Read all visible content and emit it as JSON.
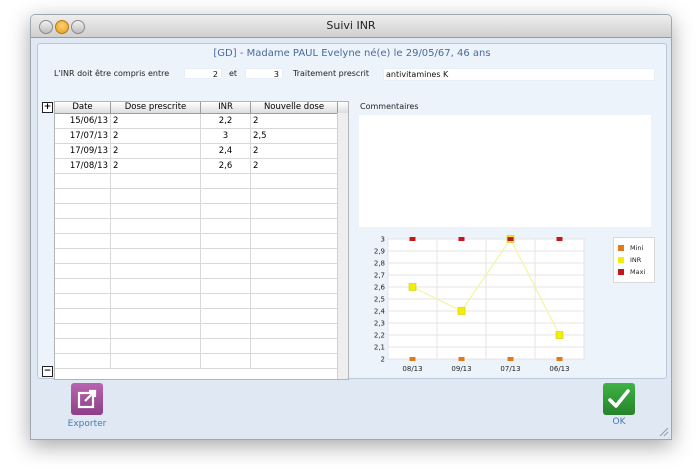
{
  "window": {
    "title": "Suivi INR"
  },
  "patient": {
    "header": "[GD] - Madame PAUL Evelyne   né(e) le 29/05/67, 46 ans"
  },
  "range": {
    "label": "L'INR doit être compris entre",
    "min": "2",
    "and_label": "et",
    "max": "3",
    "treatment_label": "Traitement prescrit",
    "treatment": "antivitamines K"
  },
  "table": {
    "add_symbol": "+",
    "remove_symbol": "−",
    "headers": [
      "Date",
      "Dose prescrite",
      "INR",
      "Nouvelle dose"
    ],
    "rows": [
      [
        "15/06/13",
        "2",
        "2,2",
        "2"
      ],
      [
        "17/07/13",
        "2",
        "3",
        "2,5"
      ],
      [
        "17/09/13",
        "2",
        "2,4",
        "2"
      ],
      [
        "17/08/13",
        "2",
        "2,6",
        "2"
      ]
    ]
  },
  "comments": {
    "label": "Commentaires",
    "value": ""
  },
  "chart_data": {
    "type": "line",
    "categories": [
      "08/13",
      "09/13",
      "07/13",
      "06/13"
    ],
    "series": [
      {
        "name": "Mini",
        "values": [
          2,
          2,
          2,
          2
        ],
        "color": "#e07b1a"
      },
      {
        "name": "INR",
        "values": [
          2.6,
          2.4,
          3,
          2.2
        ],
        "color": "#f2f000"
      },
      {
        "name": "Maxi",
        "values": [
          3,
          3,
          3,
          3
        ],
        "color": "#c41818"
      }
    ],
    "ylim": [
      2,
      3
    ],
    "yticks": [
      "2",
      "2,1",
      "2,2",
      "2,3",
      "2,4",
      "2,5",
      "2,6",
      "2,7",
      "2,8",
      "2,9",
      "3"
    ],
    "grid": true,
    "legend": "right"
  },
  "buttons": {
    "export_label": "Exporter",
    "ok_label": "OK"
  },
  "icons": {
    "export": "export-icon",
    "ok": "checkmark-icon"
  },
  "colors": {
    "header_text": "#4a6b9a",
    "export_button": "#a04a98",
    "ok_button": "#2f9a35"
  }
}
